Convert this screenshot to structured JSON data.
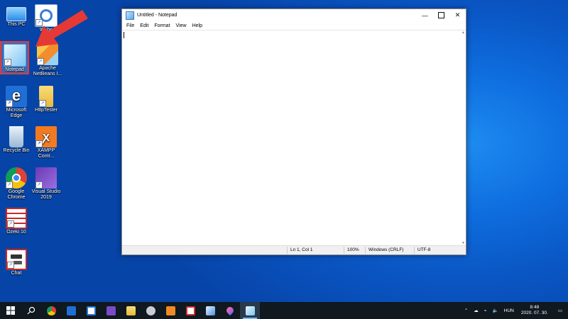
{
  "desktop": {
    "icons": [
      {
        "label": "This PC"
      },
      {
        "label": "Webe"
      },
      {
        "label": "Notepad"
      },
      {
        "label": "Apache NetBeans I..."
      },
      {
        "label": "Microsoft Edge"
      },
      {
        "label": "HttpTester"
      },
      {
        "label": "Recycle Bin"
      },
      {
        "label": "XAMPP Contr..."
      },
      {
        "label": "Google Chrome"
      },
      {
        "label": "Visual Studio 2019"
      },
      {
        "label": "Ozeki 10"
      },
      {
        "label": "Chat"
      }
    ],
    "accent": "#e53935"
  },
  "notepad": {
    "title": "Untitled - Notepad",
    "menu": [
      "File",
      "Edit",
      "Format",
      "View",
      "Help"
    ],
    "status": {
      "position": "Ln 1, Col 1",
      "zoom": "100%",
      "line_ending": "Windows (CRLF)",
      "encoding": "UTF-8"
    }
  },
  "taskbar": {
    "language": "HUN",
    "time": "8:48",
    "date": "2020. 07. 30."
  }
}
